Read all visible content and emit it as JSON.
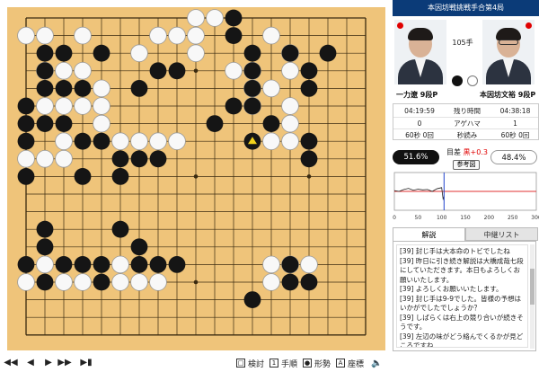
{
  "title": "本因坊戦挑戦手合第4局",
  "move_count": "105手",
  "players": {
    "black": {
      "name": "一力遼 9段P"
    },
    "white": {
      "name": "本因坊文裕 9段P"
    }
  },
  "info": {
    "rows": [
      {
        "black": "04:19:59",
        "label": "残り時間",
        "white": "04:38:18"
      },
      {
        "black": "0",
        "label": "アゲハマ",
        "white": "1"
      },
      {
        "black": "60秒 0回",
        "label": "秒読み",
        "white": "60秒 0回"
      }
    ]
  },
  "winrate": {
    "black": "51.6%",
    "white": "48.4%",
    "diff_label": "目差",
    "diff_value": "黒+0.3",
    "reference_button": "参考図"
  },
  "graph": {
    "x_ticks": [
      "0",
      "50",
      "100",
      "150",
      "200",
      "250",
      "300"
    ],
    "current_move": 105,
    "samples": [
      [
        0,
        0.52
      ],
      [
        10,
        0.5
      ],
      [
        20,
        0.55
      ],
      [
        30,
        0.58
      ],
      [
        40,
        0.53
      ],
      [
        50,
        0.56
      ],
      [
        60,
        0.54
      ],
      [
        70,
        0.55
      ],
      [
        80,
        0.5
      ],
      [
        90,
        0.57
      ],
      [
        100,
        0.6
      ],
      [
        103,
        0.3
      ],
      [
        105,
        0.36
      ]
    ]
  },
  "tabs": {
    "commentary": "解説",
    "variations": "中継リスト"
  },
  "comments": [
    "[39] 封じ手は大本命のトビでしたね",
    "[39] 昨日に引き続き解説は大橋成哉七段にしていただきます。本日もよろしくお願いいたします。",
    "[39] よろしくお願いいたします。",
    "[39] 封じ手は9-9でした。皆様の予想はいかがでしたでしょうか？",
    "[39] しばらくは右上の競り合いが続きそうです。",
    "[39] 左辺の味がどう絡んでくるかが見どころですね"
  ],
  "toolbar": {
    "nav": [
      "first-icon",
      "prev-icon",
      "play-icon",
      "next-icon",
      "last-icon"
    ],
    "buttons": [
      {
        "icon": "review-icon",
        "label": "検討"
      },
      {
        "icon": "moves-icon",
        "label": "手順"
      },
      {
        "icon": "shape-icon",
        "label": "形勢"
      },
      {
        "icon": "coordinates-icon",
        "label": "座標"
      },
      {
        "icon": "sound-icon",
        "label": ""
      }
    ]
  },
  "board": {
    "size": 19,
    "hoshi": [
      [
        3,
        3
      ],
      [
        3,
        9
      ],
      [
        3,
        15
      ],
      [
        9,
        3
      ],
      [
        9,
        9
      ],
      [
        9,
        15
      ],
      [
        15,
        3
      ],
      [
        15,
        9
      ],
      [
        15,
        15
      ]
    ],
    "last_move": [
      12,
      7
    ],
    "black": [
      [
        11,
        0
      ],
      [
        11,
        1
      ],
      [
        1,
        2
      ],
      [
        2,
        2
      ],
      [
        4,
        2
      ],
      [
        1,
        3
      ],
      [
        7,
        3
      ],
      [
        8,
        3
      ],
      [
        1,
        4
      ],
      [
        2,
        4
      ],
      [
        3,
        4
      ],
      [
        6,
        4
      ],
      [
        0,
        5
      ],
      [
        0,
        6
      ],
      [
        1,
        6
      ],
      [
        2,
        6
      ],
      [
        0,
        7
      ],
      [
        3,
        7
      ],
      [
        4,
        7
      ],
      [
        0,
        9
      ],
      [
        3,
        9
      ],
      [
        5,
        8
      ],
      [
        5,
        9
      ],
      [
        6,
        8
      ],
      [
        7,
        8
      ],
      [
        10,
        6
      ],
      [
        12,
        3
      ],
      [
        12,
        4
      ],
      [
        12,
        5
      ],
      [
        11,
        5
      ],
      [
        13,
        6
      ],
      [
        12,
        2
      ],
      [
        14,
        2
      ],
      [
        15,
        3
      ],
      [
        15,
        4
      ],
      [
        16,
        2
      ],
      [
        15,
        7
      ],
      [
        15,
        8
      ],
      [
        1,
        12
      ],
      [
        1,
        13
      ],
      [
        5,
        12
      ],
      [
        6,
        13
      ],
      [
        0,
        14
      ],
      [
        2,
        14
      ],
      [
        3,
        14
      ],
      [
        4,
        14
      ],
      [
        6,
        14
      ],
      [
        7,
        14
      ],
      [
        1,
        15
      ],
      [
        4,
        15
      ],
      [
        8,
        14
      ],
      [
        14,
        14
      ],
      [
        14,
        15
      ],
      [
        15,
        15
      ],
      [
        12,
        16
      ]
    ],
    "white": [
      [
        9,
        0
      ],
      [
        10,
        0
      ],
      [
        0,
        1
      ],
      [
        1,
        1
      ],
      [
        3,
        1
      ],
      [
        7,
        1
      ],
      [
        8,
        1
      ],
      [
        9,
        1
      ],
      [
        13,
        1
      ],
      [
        6,
        2
      ],
      [
        9,
        2
      ],
      [
        14,
        2
      ],
      [
        3,
        3
      ],
      [
        1,
        3
      ],
      [
        2,
        3
      ],
      [
        11,
        3
      ],
      [
        12,
        3
      ],
      [
        14,
        3
      ],
      [
        2,
        5
      ],
      [
        1,
        5
      ],
      [
        3,
        5
      ],
      [
        4,
        4
      ],
      [
        12,
        4
      ],
      [
        13,
        4
      ],
      [
        4,
        5
      ],
      [
        12,
        5
      ],
      [
        14,
        5
      ],
      [
        4,
        6
      ],
      [
        14,
        6
      ],
      [
        2,
        7
      ],
      [
        2,
        8
      ],
      [
        1,
        8
      ],
      [
        0,
        8
      ],
      [
        5,
        7
      ],
      [
        6,
        7
      ],
      [
        7,
        7
      ],
      [
        8,
        7
      ],
      [
        14,
        7
      ],
      [
        13,
        7
      ],
      [
        1,
        14
      ],
      [
        2,
        15
      ],
      [
        3,
        15
      ],
      [
        5,
        14
      ],
      [
        5,
        15
      ],
      [
        6,
        15
      ],
      [
        7,
        15
      ],
      [
        13,
        14
      ],
      [
        14,
        14
      ],
      [
        0,
        15
      ],
      [
        15,
        14
      ],
      [
        13,
        15
      ]
    ]
  }
}
